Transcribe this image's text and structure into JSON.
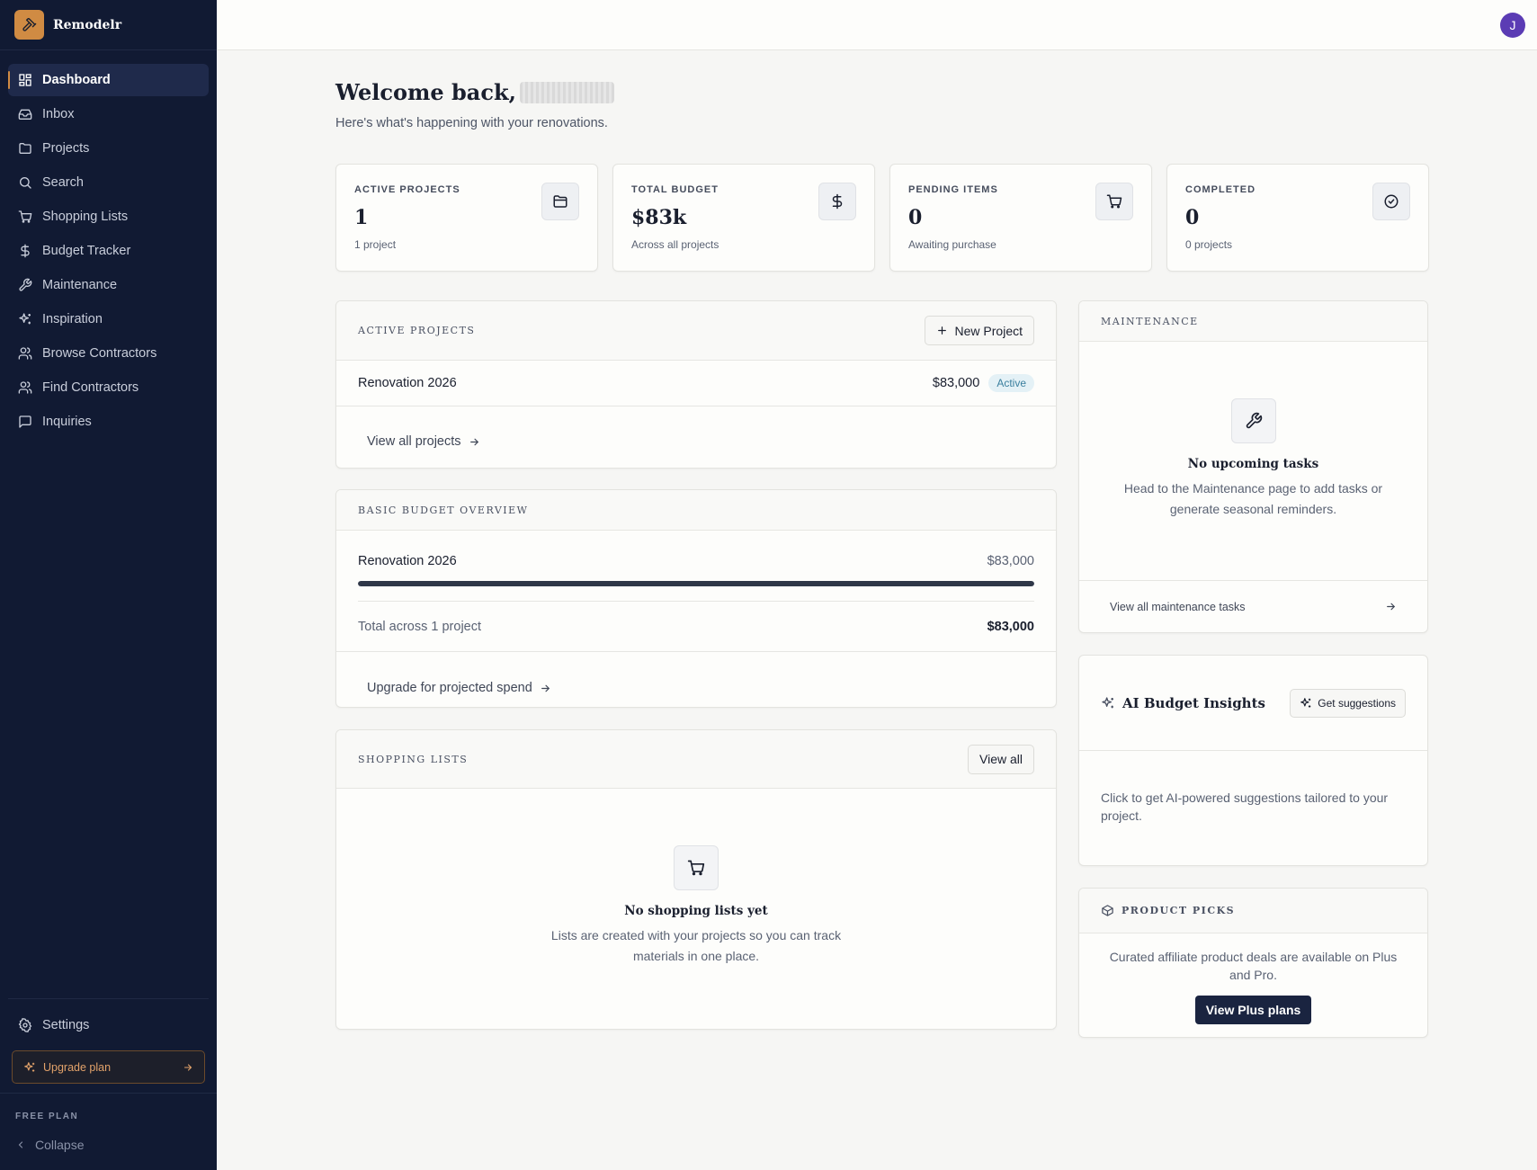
{
  "brand": {
    "name": "Remodelr"
  },
  "nav": [
    {
      "label": "Dashboard",
      "icon": "grid-icon"
    },
    {
      "label": "Inbox",
      "icon": "inbox-icon"
    },
    {
      "label": "Projects",
      "icon": "folder-icon"
    },
    {
      "label": "Search",
      "icon": "search-icon"
    },
    {
      "label": "Shopping Lists",
      "icon": "cart-icon"
    },
    {
      "label": "Budget Tracker",
      "icon": "dollar-icon"
    },
    {
      "label": "Maintenance",
      "icon": "wrench-icon"
    },
    {
      "label": "Inspiration",
      "icon": "sparkles-icon"
    },
    {
      "label": "Browse Contractors",
      "icon": "users-icon"
    },
    {
      "label": "Find Contractors",
      "icon": "users-icon"
    },
    {
      "label": "Inquiries",
      "icon": "message-icon"
    }
  ],
  "sidebar_bottom": {
    "settings": "Settings",
    "upgrade": "Upgrade plan",
    "plan": "FREE PLAN",
    "collapse": "Collapse"
  },
  "user": {
    "initial": "J"
  },
  "header": {
    "welcome": "Welcome back,",
    "subtitle": "Here's what's happening with your renovations."
  },
  "stats": [
    {
      "label": "ACTIVE PROJECTS",
      "value": "1",
      "sub": "1 project",
      "icon": "folder-icon"
    },
    {
      "label": "TOTAL BUDGET",
      "value": "$83k",
      "sub": "Across all projects",
      "icon": "dollar-icon"
    },
    {
      "label": "PENDING ITEMS",
      "value": "0",
      "sub": "Awaiting purchase",
      "icon": "cart-icon"
    },
    {
      "label": "COMPLETED",
      "value": "0",
      "sub": "0 projects",
      "icon": "check-circle-icon"
    }
  ],
  "active_projects": {
    "title": "ACTIVE PROJECTS",
    "new_button": "New Project",
    "project_name": "Renovation 2026",
    "project_amount": "$83,000",
    "status": "Active",
    "view_all": "View all projects"
  },
  "budget": {
    "title": "BASIC BUDGET OVERVIEW",
    "project_name": "Renovation 2026",
    "project_amount": "$83,000",
    "progress_fraction": 1.0,
    "total_label": "Total across 1 project",
    "total_value": "$83,000",
    "upgrade_link": "Upgrade for projected spend"
  },
  "shopping": {
    "title": "SHOPPING LISTS",
    "view_all": "View all",
    "empty_title": "No shopping lists yet",
    "empty_text_1": "Lists are created with your projects so you can track",
    "empty_text_2": "materials in one place."
  },
  "maintenance": {
    "title": "MAINTENANCE",
    "empty_title": "No upcoming tasks",
    "empty_text_1": "Head to the Maintenance page to add tasks or",
    "empty_text_2": "generate seasonal reminders.",
    "view_all": "View all maintenance tasks"
  },
  "ai": {
    "title": "AI Budget Insights",
    "button": "Get suggestions",
    "text_1": "Click to get AI-powered suggestions tailored to your",
    "text_2": "project."
  },
  "products": {
    "title": "PRODUCT PICKS",
    "text_1": "Curated affiliate product deals are available on Plus",
    "text_2": "and Pro.",
    "button": "View Plus plans"
  },
  "colors": {
    "sidebar_bg": "#111a33",
    "accent": "#d08b43",
    "avatar": "#5b3cb4",
    "badge_text": "#3a7f9e"
  }
}
